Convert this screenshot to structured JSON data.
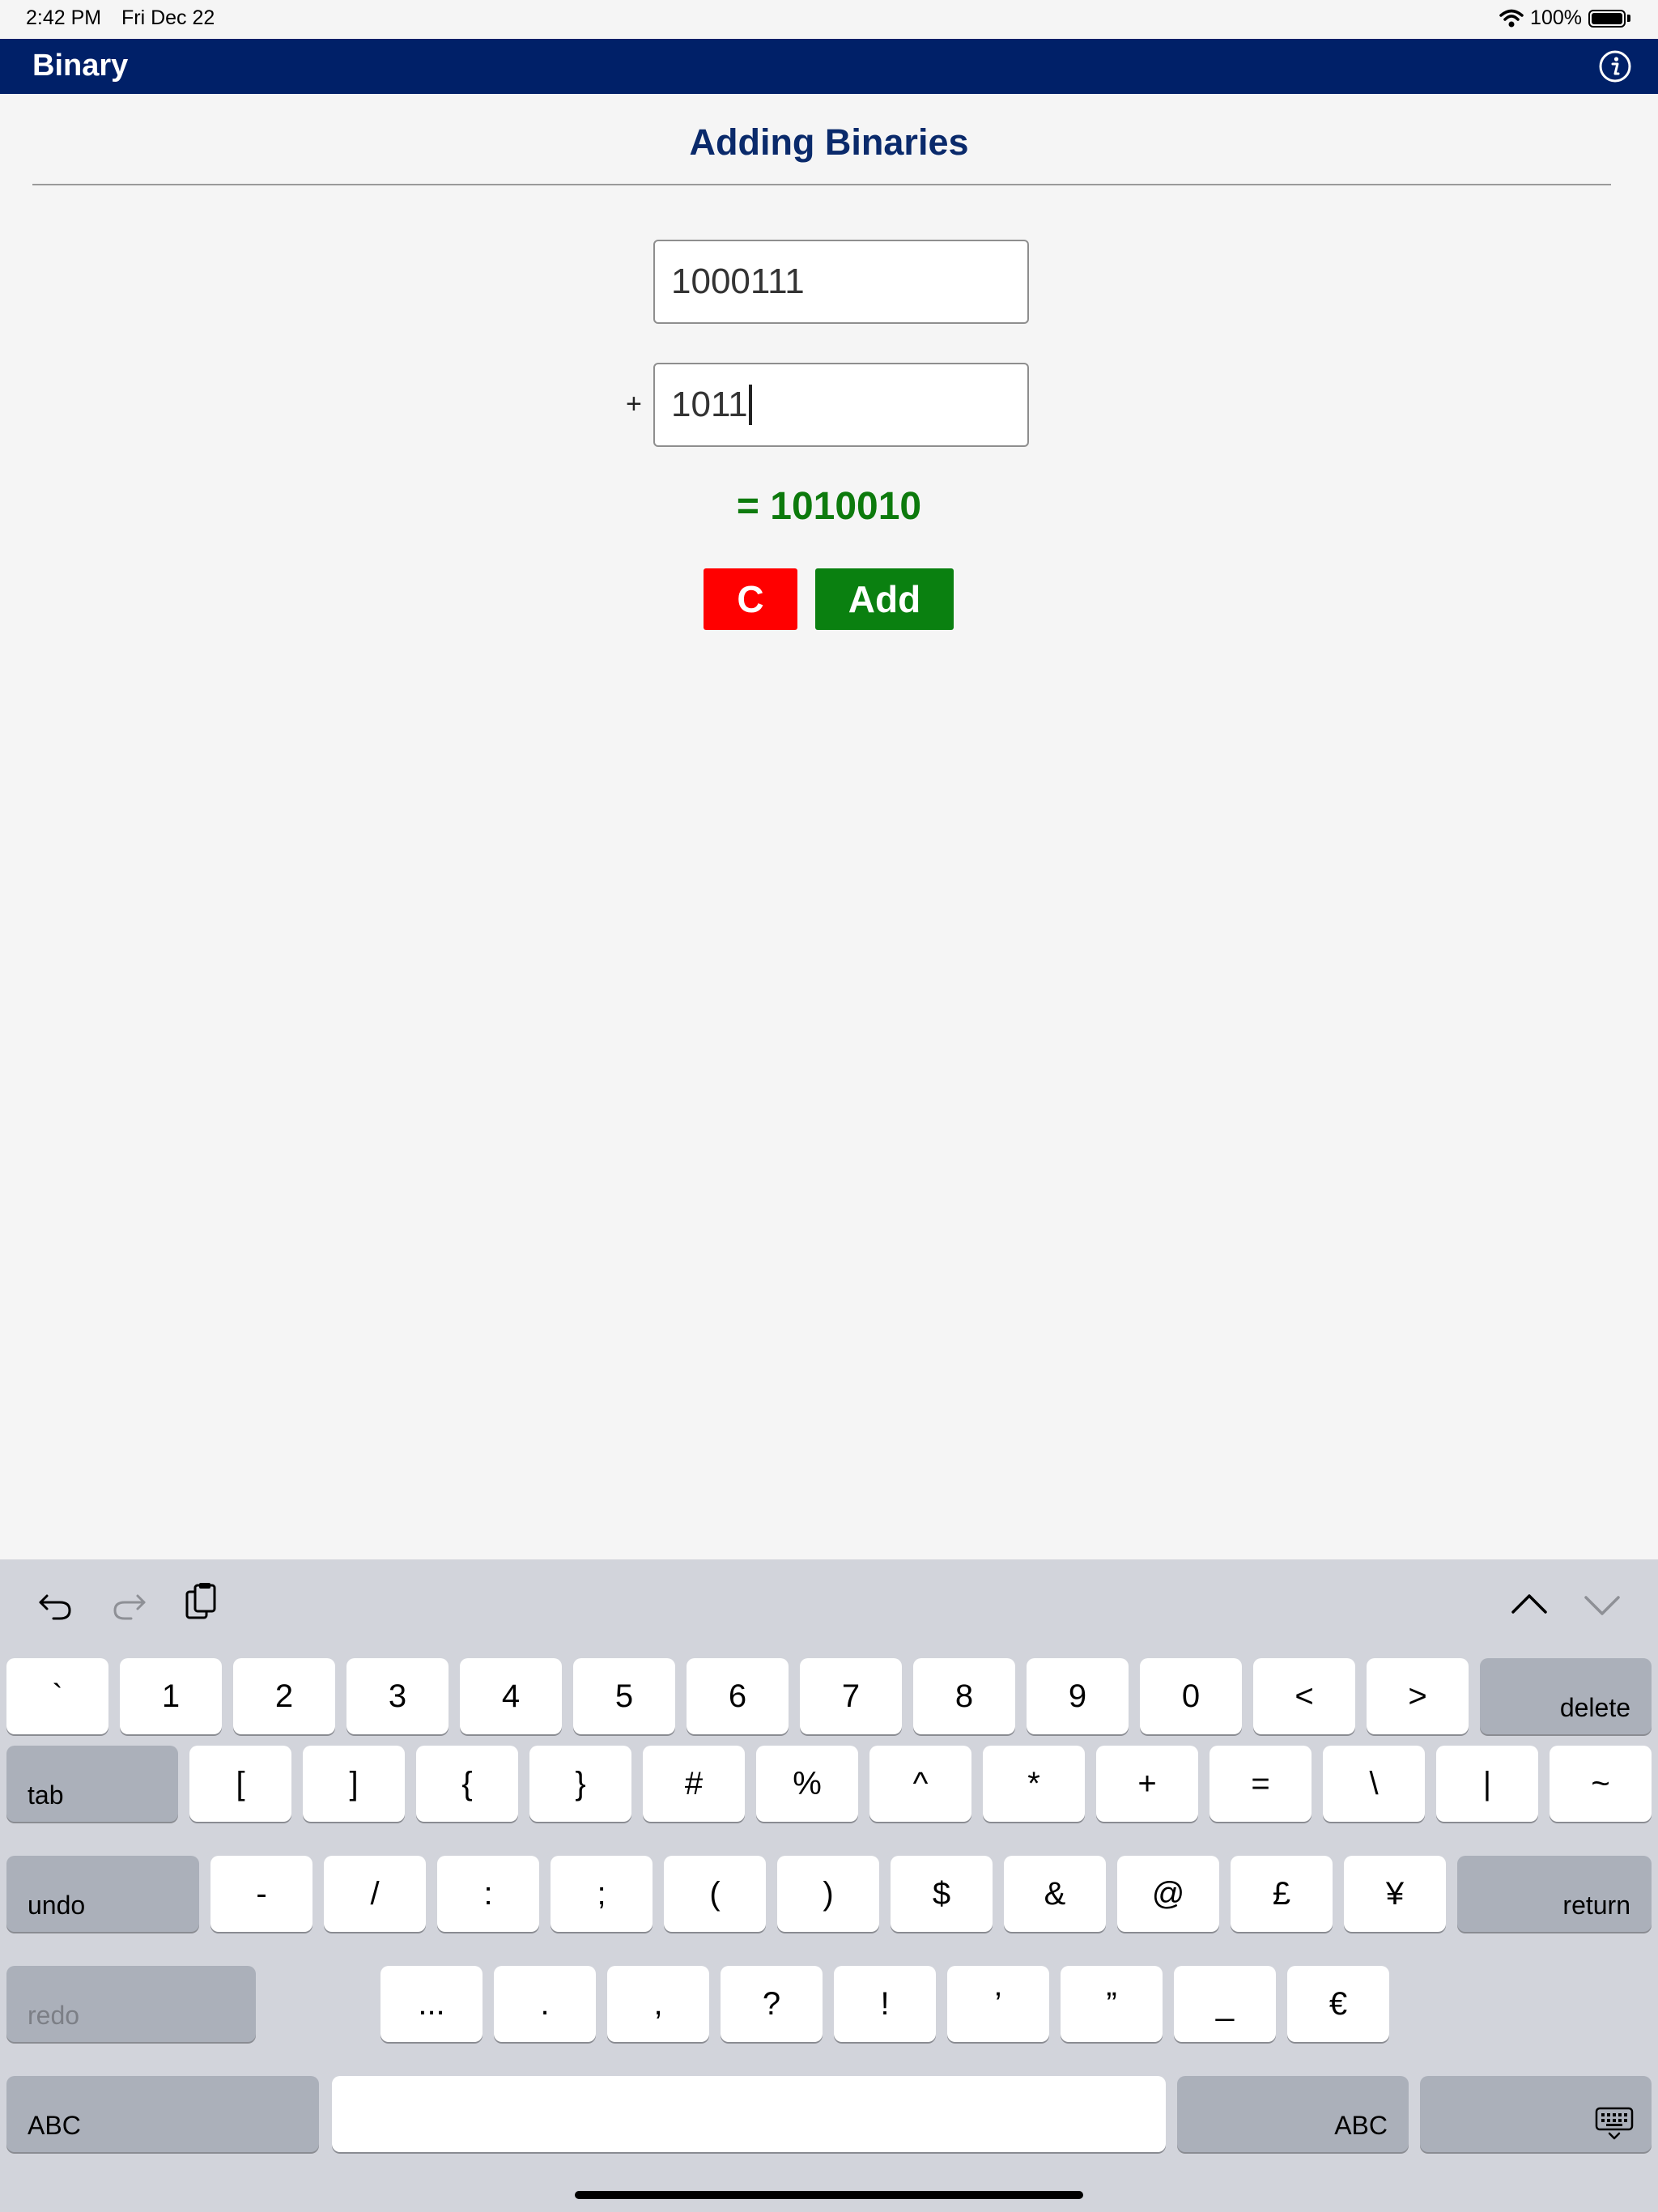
{
  "status_bar": {
    "time": "2:42 PM",
    "date": "Fri Dec 22",
    "battery": "100%"
  },
  "nav": {
    "title": "Binary",
    "info_icon": "info-icon"
  },
  "page": {
    "title": "Adding Binaries",
    "first_value": "1000111",
    "plus": "+",
    "second_value": "1011",
    "result": "= 1010010",
    "clear_label": "C",
    "add_label": "Add"
  },
  "colors": {
    "nav": "#002068",
    "title": "#0a2a6b",
    "result": "#0d7a0d",
    "clear": "#ff0000",
    "add": "#0a8010"
  },
  "keyboard": {
    "toolbar": [
      "undo-arrow-icon",
      "redo-arrow-icon",
      "paste-icon",
      "chevron-up-icon",
      "chevron-down-icon"
    ],
    "row1": [
      "`",
      "1",
      "2",
      "3",
      "4",
      "5",
      "6",
      "7",
      "8",
      "9",
      "0",
      "<",
      ">"
    ],
    "delete": "delete",
    "tab": "tab",
    "row2": [
      "[",
      "]",
      "{",
      "}",
      "#",
      "%",
      "^",
      "*",
      "+",
      "=",
      "\\",
      "|",
      "~"
    ],
    "undo": "undo",
    "row3": [
      "-",
      "/",
      ":",
      ";",
      "(",
      ")",
      "$",
      "&",
      "@",
      "£",
      "¥"
    ],
    "return": "return",
    "redo": "redo",
    "row4": [
      "...",
      ".",
      ",",
      "?",
      "!",
      "’",
      "”",
      "_",
      "€"
    ],
    "abc_left": "ABC",
    "abc_right": "ABC",
    "dismiss_icon": "keyboard-dismiss-icon"
  }
}
